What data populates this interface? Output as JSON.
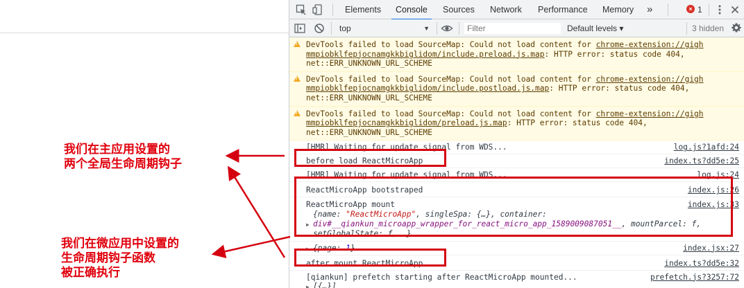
{
  "annotations": {
    "top_lines": [
      "我们在主应用设置的",
      "两个全局生命周期钩子"
    ],
    "bottom_lines": [
      "我们在微应用中设置的",
      "生命周期钩子函数",
      "被正确执行"
    ],
    "color": "#e0000d"
  },
  "devtools": {
    "tabs": [
      "Elements",
      "Console",
      "Sources",
      "Network",
      "Performance",
      "Memory"
    ],
    "active_tab": "Console",
    "more_tabs": "»",
    "error_count": "1",
    "error_badge": "×",
    "toolbar": {
      "context": "top",
      "filter_placeholder": "Filter",
      "levels": "Default levels ▾",
      "hidden": "3 hidden"
    },
    "warnings": [
      {
        "prefix": "DevTools failed to load SourceMap: Could not load content for ",
        "link1": "chrome-extension://gigh",
        "link2": "mmpiobklfepjocnamgkkbiglidom/include.preload.js.map",
        "suffix": ": HTTP error: status code 404,",
        "line3": "net::ERR_UNKNOWN_URL_SCHEME"
      },
      {
        "prefix": "DevTools failed to load SourceMap: Could not load content for ",
        "link1": "chrome-extension://gigh",
        "link2": "mmpiobklfepjocnamgkkbiglidom/include.postload.js.map",
        "suffix": ": HTTP error: status code 404,",
        "line3": "net::ERR_UNKNOWN_URL_SCHEME"
      },
      {
        "prefix": "DevTools failed to load SourceMap: Could not load content for ",
        "link1": "chrome-extension://gigh",
        "link2": "mmpiobklfepjocnamgkkbiglidom/preload.js.map",
        "suffix": ": HTTP error: status code 404,",
        "line3": "net::ERR_UNKNOWN_URL_SCHEME"
      }
    ],
    "logs": {
      "hmr1": {
        "text": "[HMR] Waiting for update signal from WDS...",
        "src": "log.js?1afd:24"
      },
      "before_load": {
        "text": "before load ReactMicroApp",
        "src": "index.ts?dd5e:25"
      },
      "hmr2": {
        "text": "[HMR] Waiting for update signal from WDS...",
        "src": "log.js:24"
      },
      "bootstrap": {
        "text": "ReactMicroApp bootstraped",
        "src": "index.js:26"
      },
      "mount": {
        "text": "ReactMicroApp mount",
        "src": "index.js:33",
        "obj_line1_a": "{name: ",
        "obj_line1_str": "\"ReactMicroApp\"",
        "obj_line1_b": ", singleSpa: {…}, container:",
        "obj_line2_dom": "div#__qiankun_microapp_wrapper_for_react_micro_app_1589009087051__",
        "obj_line2_b": ", mountParcel: f,",
        "obj_line3": "setGlobalState: f, …}"
      },
      "page": {
        "a": "{page: ",
        "num": "1",
        "b": "}",
        "src": "index.jsx:27"
      },
      "after_mount": {
        "text": "after mount ReactMicroApp",
        "src": "index.ts?dd5e:32"
      },
      "prefetch": {
        "text": "[qiankun] prefetch starting after ReactMicroApp mounted...",
        "src": "prefetch.js?3257:72"
      },
      "array": "[{…}]"
    }
  },
  "colors": {
    "accent": "#1a73e8",
    "highlight_box": "#d5000f",
    "warning_bg": "#fffbe5",
    "error_badge": "#d93025"
  }
}
